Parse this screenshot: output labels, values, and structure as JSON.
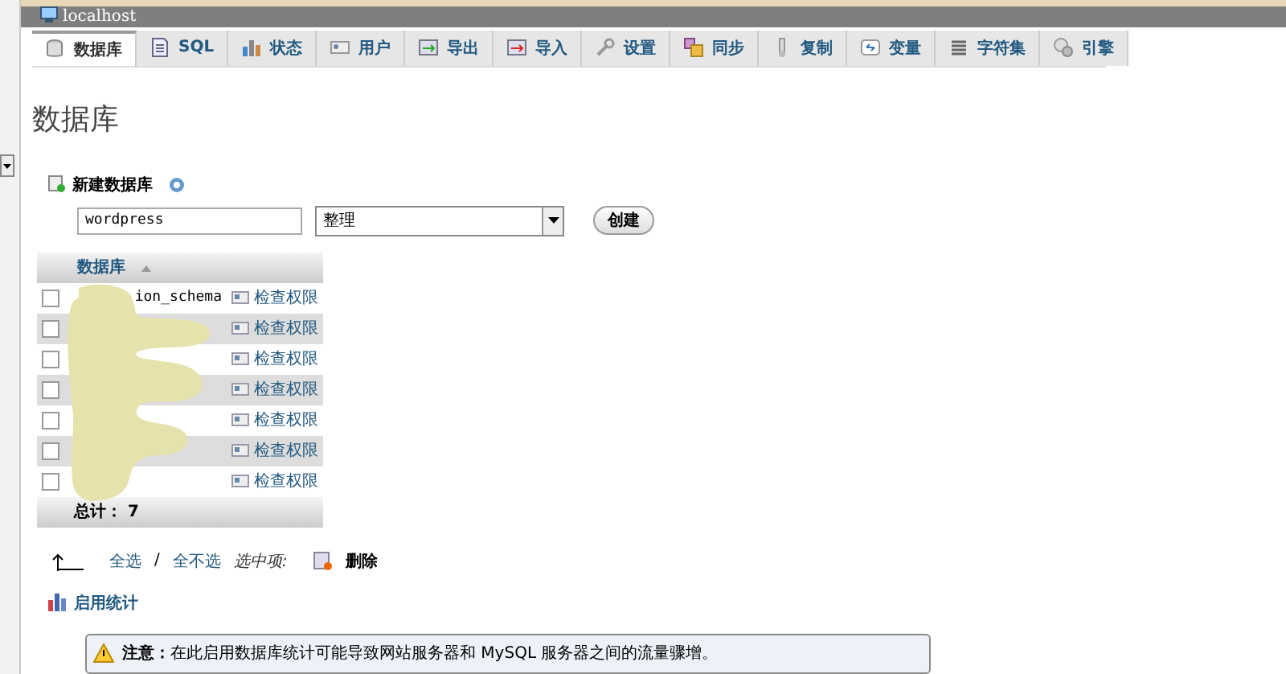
{
  "server": {
    "title": "localhost"
  },
  "tabs": [
    {
      "label": "数据库",
      "selected": true
    },
    {
      "label": "SQL",
      "selected": false
    },
    {
      "label": "状态",
      "selected": false
    },
    {
      "label": "用户",
      "selected": false
    },
    {
      "label": "导出",
      "selected": false
    },
    {
      "label": "导入",
      "selected": false
    },
    {
      "label": "设置",
      "selected": false
    },
    {
      "label": "同步",
      "selected": false
    },
    {
      "label": "复制",
      "selected": false
    },
    {
      "label": "变量",
      "selected": false
    },
    {
      "label": "字符集",
      "selected": false
    },
    {
      "label": "引擎",
      "selected": false
    }
  ],
  "page_title": "数据库",
  "create_db": {
    "title": "新建数据库",
    "name_value": "wordpress",
    "collation_value": "整理",
    "button": "创建"
  },
  "table": {
    "columns": [
      {
        "label": "数据库",
        "sorted": true
      }
    ],
    "rows": [
      {
        "name": "ion_schema",
        "checked": false,
        "privileges": "检查权限"
      },
      {
        "checked": false,
        "privileges": "检查权限"
      },
      {
        "checked": false,
        "privileges": "检查权限"
      },
      {
        "checked": false,
        "privileges": "检查权限"
      },
      {
        "checked": false,
        "privileges": "检查权限"
      },
      {
        "checked": false,
        "privileges": "检查权限"
      },
      {
        "checked": false,
        "privileges": "检查权限"
      }
    ],
    "footer": "总计： 7"
  },
  "bulk": {
    "check_all": "全选",
    "separator": "/",
    "uncheck_all": "全不选",
    "with_selected": "选中项:",
    "delete": "删除"
  },
  "stats": {
    "title": "启用统计",
    "notice": "**注意：**在此启用数据库统计可能导致网站服务器和 MySQL 服务器之间的流量骤增。"
  }
}
